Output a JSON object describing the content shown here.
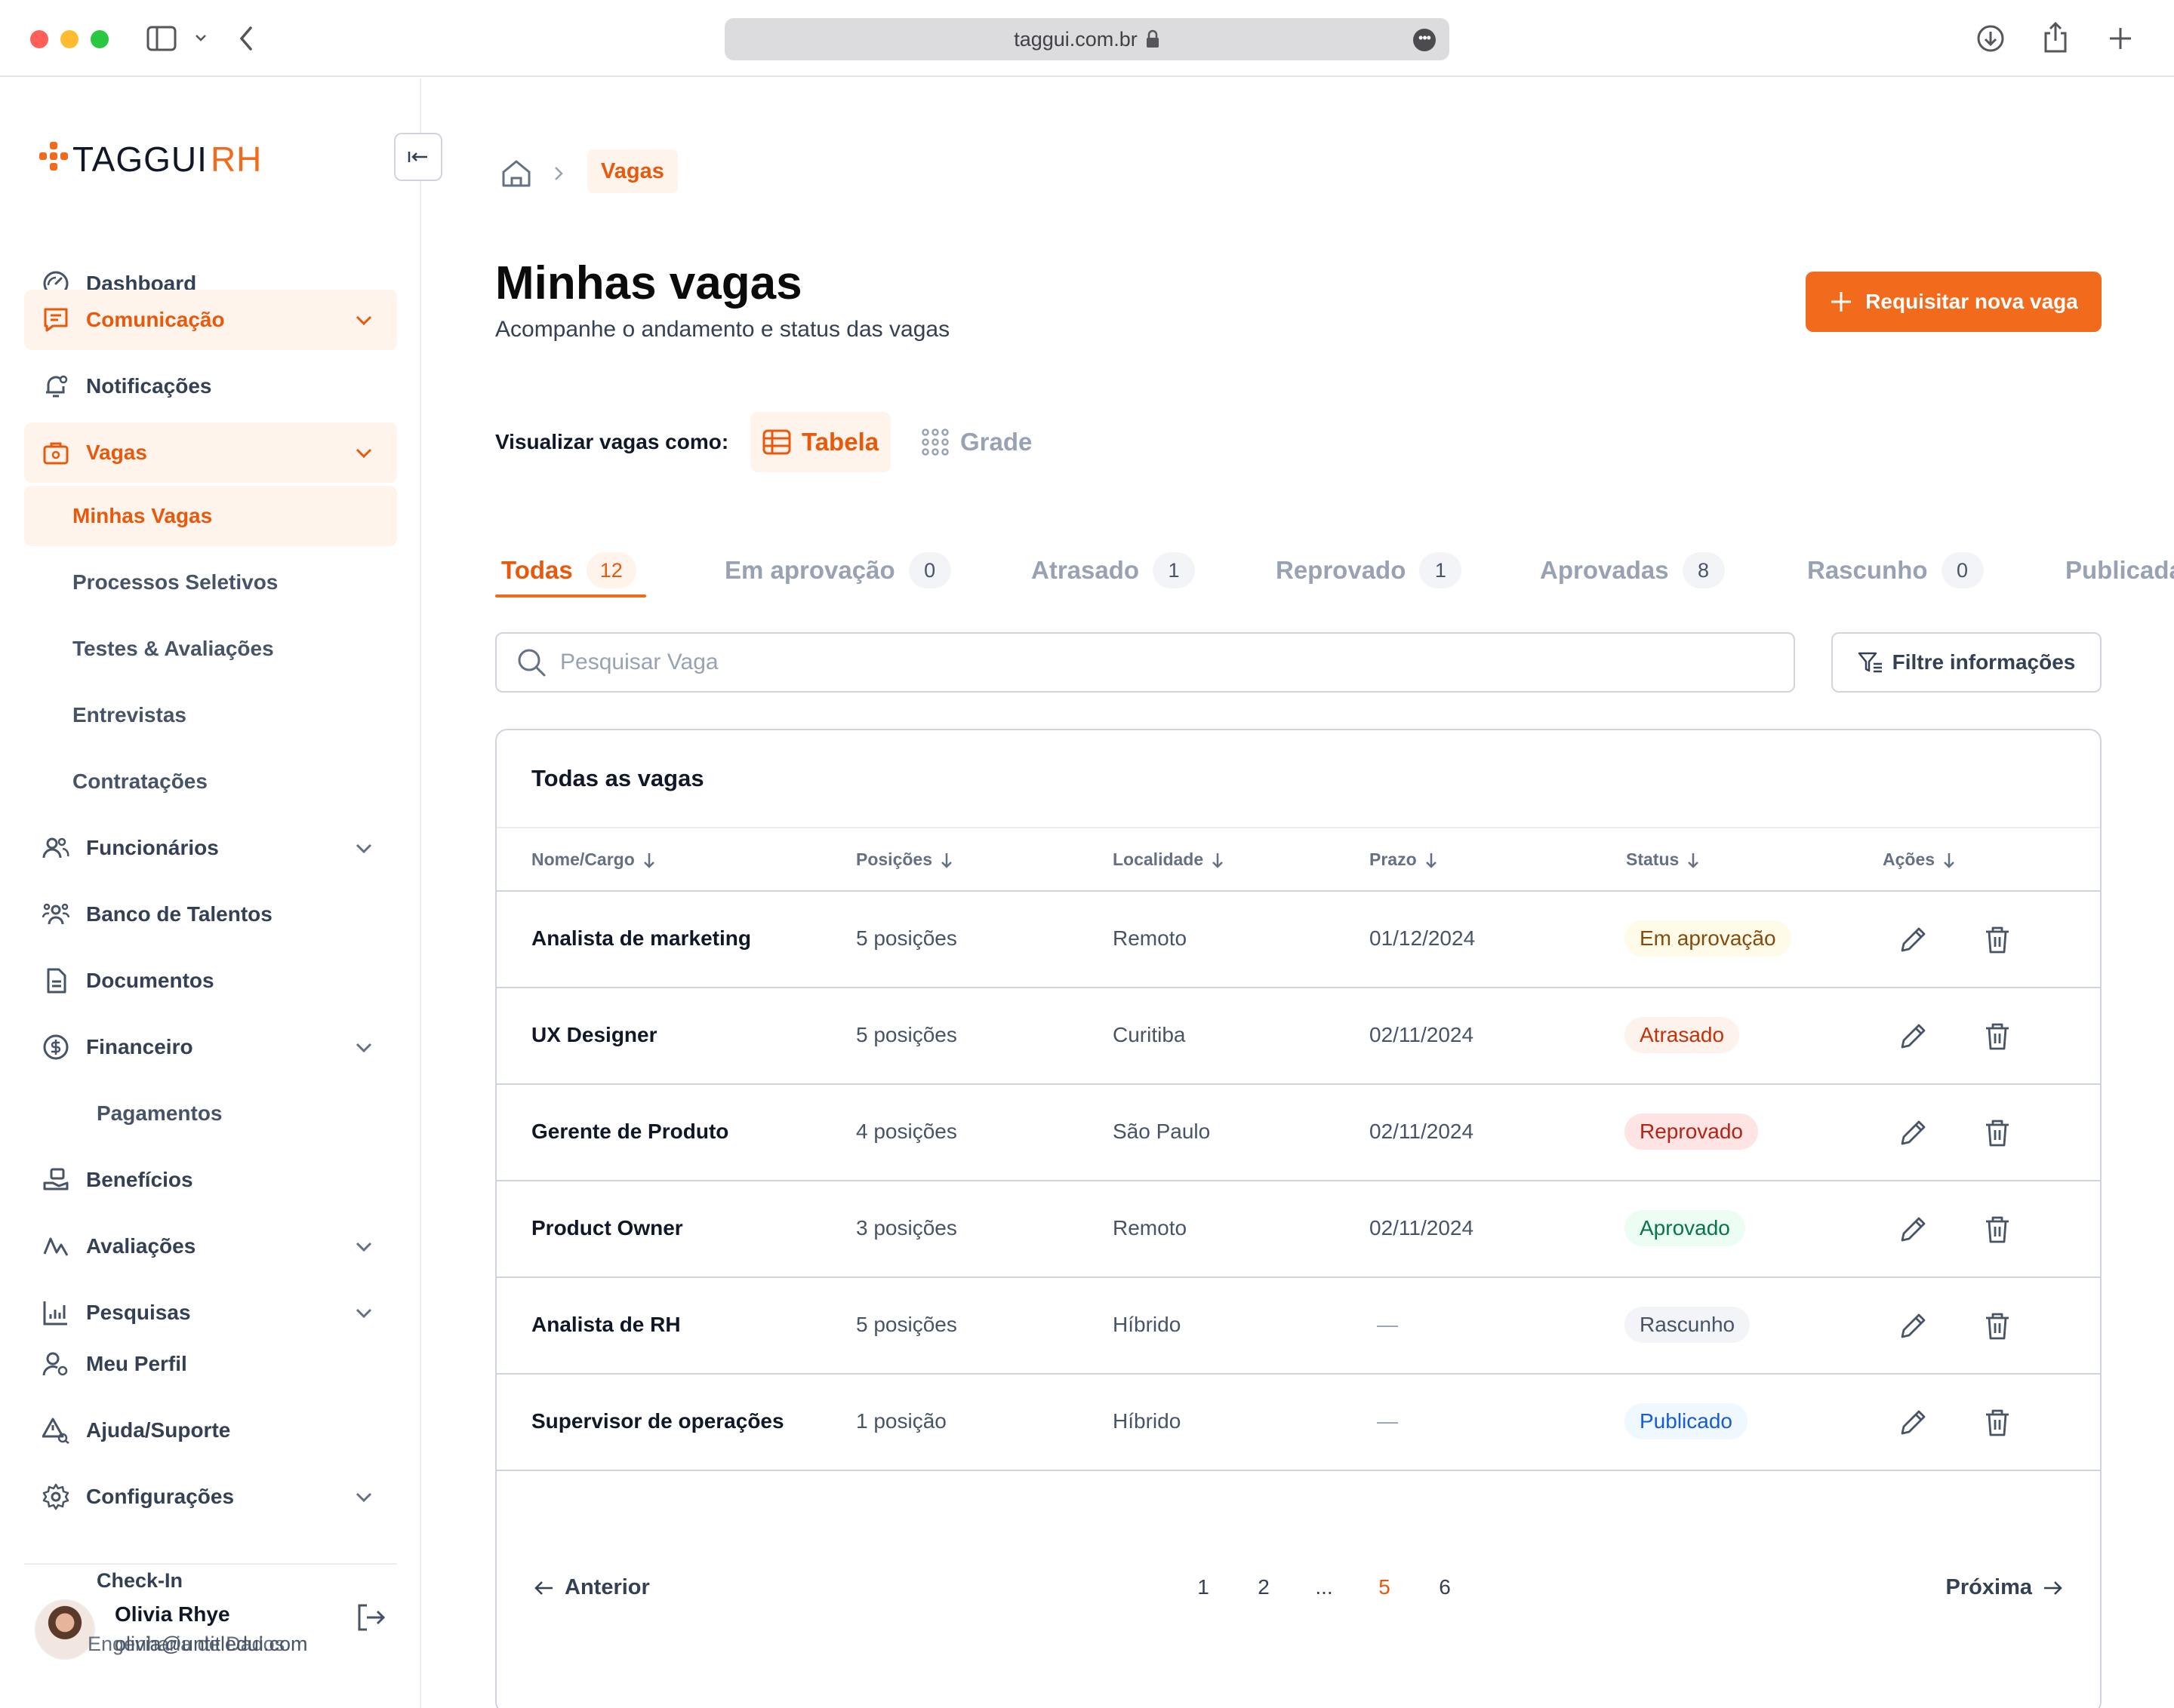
{
  "browser": {
    "url": "taggui.com.br",
    "colors": {
      "close": "#ff5f57",
      "minimize": "#febc2e",
      "maximize": "#28c840"
    }
  },
  "brand": {
    "name_part1": "TAGGUI",
    "name_part2": "RH",
    "accent": "#f26b1d"
  },
  "sidebar": {
    "items": [
      {
        "label": "Dashboard",
        "icon": "dashboard-gauge-icon"
      },
      {
        "label": "Comunicação",
        "icon": "message-icon",
        "expanded": true
      },
      {
        "label": "Notificações",
        "icon": "bell-icon"
      },
      {
        "label": "Vagas",
        "icon": "briefcase-icon",
        "expanded": true
      },
      {
        "label": "Funcionários",
        "icon": "users-icon"
      },
      {
        "label": "Banco de Talentos",
        "icon": "talents-icon"
      },
      {
        "label": "Documentos",
        "icon": "document-icon"
      },
      {
        "label": "Financeiro",
        "icon": "dollar-icon"
      },
      {
        "label": "Benefícios",
        "icon": "gift-hand-icon"
      },
      {
        "label": "Avaliações",
        "icon": "chart-line-icon"
      },
      {
        "label": "Pesquisas",
        "icon": "bar-chart-icon"
      },
      {
        "label": "Meu Perfil",
        "icon": "user-settings-icon"
      },
      {
        "label": "Ajuda/Suporte",
        "icon": "help-icon"
      },
      {
        "label": "Configurações",
        "icon": "gear-icon"
      }
    ],
    "vagas_sub": [
      "Minhas Vagas",
      "Processos Seletivos",
      "Testes & Avaliações",
      "Entrevistas",
      "Contratações"
    ],
    "financeiro_sub": [
      "Pagamentos"
    ],
    "checkin": "Check-In",
    "user": {
      "name": "Olivia Rhye",
      "email": "olivia@untitledui.com",
      "role": "Engenharia de Dados"
    }
  },
  "breadcrumb": {
    "current": "Vagas"
  },
  "header": {
    "title": "Minhas vagas",
    "subtitle": "Acompanhe o andamento e status das vagas",
    "primary_button": "Requisitar nova vaga"
  },
  "view": {
    "label": "Visualizar vagas como:",
    "options": [
      "Tabela",
      "Grade"
    ],
    "selected": "Tabela"
  },
  "tabs": [
    {
      "label": "Todas",
      "count": "12"
    },
    {
      "label": "Em aprovação",
      "count": "0"
    },
    {
      "label": "Atrasado",
      "count": "1"
    },
    {
      "label": "Reprovado",
      "count": "1"
    },
    {
      "label": "Aprovadas",
      "count": "8"
    },
    {
      "label": "Rascunho",
      "count": "0"
    },
    {
      "label": "Publicada",
      "count": ""
    }
  ],
  "search": {
    "placeholder": "Pesquisar Vaga"
  },
  "filter_button": "Filtre informações",
  "table": {
    "title": "Todas as vagas",
    "columns": [
      "Nome/Cargo",
      "Posições",
      "Localidade",
      "Prazo",
      "Status",
      "Ações"
    ],
    "rows": [
      {
        "name": "Analista de marketing",
        "positions": "5 posições",
        "location": "Remoto",
        "deadline": "01/12/2024",
        "status": "Em aprovação"
      },
      {
        "name": "UX Designer",
        "positions": "5 posições",
        "location": "Curitiba",
        "deadline": "02/11/2024",
        "status": "Atrasado"
      },
      {
        "name": "Gerente de Produto",
        "positions": "4 posições",
        "location": "São Paulo",
        "deadline": "02/11/2024",
        "status": "Reprovado"
      },
      {
        "name": "Product Owner",
        "positions": "3 posições",
        "location": "Remoto",
        "deadline": "02/11/2024",
        "status": "Aprovado"
      },
      {
        "name": "Analista de RH",
        "positions": "5 posições",
        "location": "Híbrido",
        "deadline": "—",
        "status": "Rascunho"
      },
      {
        "name": "Supervisor de operações",
        "positions": "1 posição",
        "location": "Híbrido",
        "deadline": "—",
        "status": "Publicado"
      }
    ],
    "status_colors": {
      "Em aprovação": {
        "bg": "#fefbe8",
        "fg": "#854a0e"
      },
      "Atrasado": {
        "bg": "#fef3ec",
        "fg": "#c4320a"
      },
      "Reprovado": {
        "bg": "#fee4e2",
        "fg": "#b42318"
      },
      "Aprovado": {
        "bg": "#ecfdf3",
        "fg": "#067647"
      },
      "Rascunho": {
        "bg": "#f2f4f7",
        "fg": "#475467"
      },
      "Publicado": {
        "bg": "#eff8ff",
        "fg": "#175cd3"
      }
    }
  },
  "pagination": {
    "prev": "Anterior",
    "next": "Próxima",
    "pages": [
      "1",
      "2",
      "...",
      "5",
      "6"
    ],
    "current": "5"
  }
}
